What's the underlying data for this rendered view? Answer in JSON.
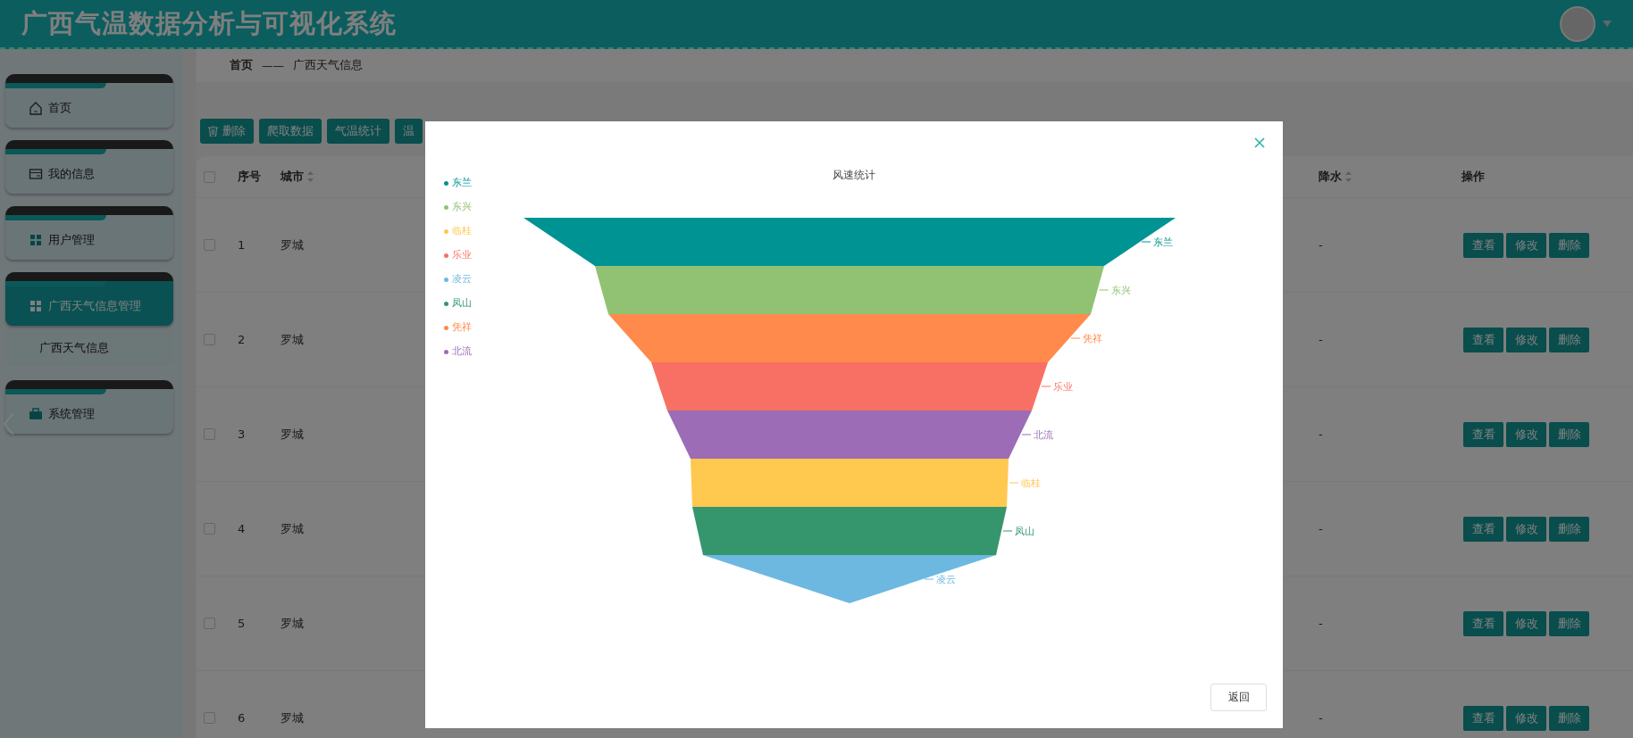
{
  "header": {
    "title": "广西气温数据分析与可视化系统"
  },
  "sidebar": {
    "items": [
      {
        "label": "首页",
        "selected": false
      },
      {
        "label": "我的信息",
        "selected": false
      },
      {
        "label": "用户管理",
        "selected": false
      },
      {
        "label": "广西天气信息管理",
        "selected": true,
        "children": [
          {
            "label": "广西天气信息",
            "selected": false
          }
        ]
      },
      {
        "label": "系统管理",
        "selected": false
      }
    ]
  },
  "breadcrumb": {
    "items": [
      "首页",
      "广西天气信息"
    ],
    "separator": "——"
  },
  "toolbar": {
    "buttons": [
      {
        "label": "删除",
        "kind": "icon"
      },
      {
        "label": "爬取数据",
        "kind": "text"
      },
      {
        "label": "气温统计",
        "kind": "text"
      },
      {
        "label": "温",
        "kind": "text"
      }
    ]
  },
  "table": {
    "all_checked": false,
    "columns": [
      {
        "label": "序号",
        "sortable": false
      },
      {
        "label": "城市",
        "sortable": true
      },
      {
        "label": "降水",
        "sortable": true
      },
      {
        "label": "操作",
        "sortable": false
      }
    ],
    "rows": [
      {
        "checked": false,
        "index": "1",
        "city": "罗城",
        "precipitation": "-",
        "actions": [
          "查看",
          "修改",
          "删除"
        ]
      },
      {
        "checked": false,
        "index": "2",
        "city": "罗城",
        "precipitation": "-",
        "actions": [
          "查看",
          "修改",
          "删除"
        ]
      },
      {
        "checked": false,
        "index": "3",
        "city": "罗城",
        "precipitation": "-",
        "actions": [
          "查看",
          "修改",
          "删除"
        ]
      },
      {
        "checked": false,
        "index": "4",
        "city": "罗城",
        "precipitation": "-",
        "actions": [
          "查看",
          "修改",
          "删除"
        ]
      },
      {
        "checked": false,
        "index": "5",
        "city": "罗城",
        "precipitation": "-",
        "actions": [
          "查看",
          "修改",
          "删除"
        ]
      },
      {
        "checked": false,
        "index": "6",
        "city": "罗城",
        "precipitation": "-",
        "actions": [
          "查看",
          "修改",
          "删除"
        ]
      }
    ]
  },
  "modal": {
    "chart_title": "风速统计",
    "legend": [
      {
        "label": "东兰",
        "color": "#009393"
      },
      {
        "label": "东兴",
        "color": "#91c273"
      },
      {
        "label": "临桂",
        "color": "#ffc84f"
      },
      {
        "label": "乐业",
        "color": "#f87063"
      },
      {
        "label": "凌云",
        "color": "#6cb8e0"
      },
      {
        "label": "凤山",
        "color": "#35966d"
      },
      {
        "label": "凭祥",
        "color": "#ff8a4c"
      },
      {
        "label": "北流",
        "color": "#9c6cb6"
      }
    ],
    "funnel": [
      {
        "label": "东兰",
        "color": "#009393"
      },
      {
        "label": "东兴",
        "color": "#91c273"
      },
      {
        "label": "凭祥",
        "color": "#ff8a4c"
      },
      {
        "label": "乐业",
        "color": "#f87063"
      },
      {
        "label": "北流",
        "color": "#9c6cb6"
      },
      {
        "label": "临桂",
        "color": "#ffc84f"
      },
      {
        "label": "凤山",
        "color": "#35966d"
      },
      {
        "label": "凌云",
        "color": "#6cb8e0"
      }
    ],
    "buttons": [
      "返回"
    ]
  }
}
